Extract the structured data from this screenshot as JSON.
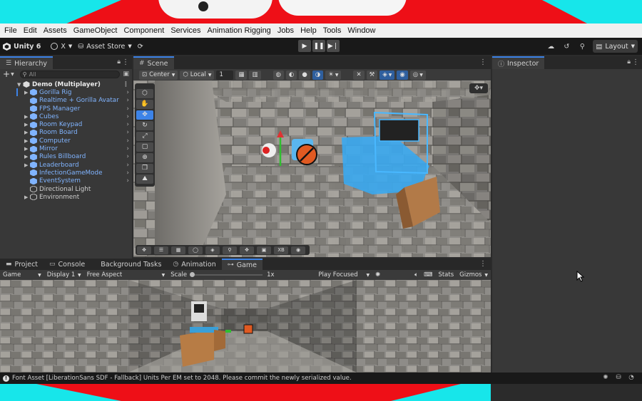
{
  "menu": [
    "File",
    "Edit",
    "Assets",
    "GameObject",
    "Component",
    "Services",
    "Animation Rigging",
    "Jobs",
    "Help",
    "Tools",
    "Window"
  ],
  "toolbar": {
    "app_name": "Unity 6",
    "account_label": "X",
    "asset_store_label": "Asset Store",
    "layout_label": "Layout"
  },
  "hierarchy": {
    "tab_label": "Hierarchy",
    "search_placeholder": "All",
    "root": "Demo (Multiplayer)",
    "items": [
      {
        "label": "Gorilla Rig",
        "prefab": true,
        "expandable": true
      },
      {
        "label": "Realtime + Gorilla Avatar",
        "prefab": true,
        "expandable": false
      },
      {
        "label": "FPS Manager",
        "prefab": true,
        "expandable": false
      },
      {
        "label": "Cubes",
        "prefab": true,
        "expandable": true
      },
      {
        "label": "Room Keypad",
        "prefab": true,
        "expandable": true
      },
      {
        "label": "Room Board",
        "prefab": true,
        "expandable": true
      },
      {
        "label": "Computer",
        "prefab": true,
        "expandable": true
      },
      {
        "label": "Mirror",
        "prefab": true,
        "expandable": true
      },
      {
        "label": "Rules Billboard",
        "prefab": true,
        "expandable": true
      },
      {
        "label": "Leaderboard",
        "prefab": true,
        "expandable": true
      },
      {
        "label": "InfectionGameMode",
        "prefab": true,
        "expandable": false
      },
      {
        "label": "EventSystem",
        "prefab": true,
        "expandable": false
      },
      {
        "label": "Directional Light",
        "prefab": false,
        "expandable": false
      },
      {
        "label": "Environment",
        "prefab": false,
        "expandable": true
      }
    ]
  },
  "scene": {
    "tab_label": "Scene",
    "pivot_label": "Center",
    "space_label": "Local",
    "grid_value": "1",
    "bottom_tool_label": "XB"
  },
  "inspector": {
    "tab_label": "Inspector"
  },
  "bottom": {
    "tabs": [
      "Project",
      "Console",
      "Background Tasks",
      "Animation",
      "Game"
    ],
    "active_tab": "Game",
    "game_bar": {
      "mode": "Game",
      "display": "Display 1",
      "aspect": "Free Aspect",
      "scale_label": "Scale",
      "scale_value": "1x",
      "play_mode": "Play Focused",
      "stats_label": "Stats",
      "gizmos_label": "Gizmos"
    }
  },
  "status": {
    "message": "Font Asset [LiberationSans SDF - Fallback] Units Per EM set to 2048. Please commit the newly serialized value."
  },
  "colors": {
    "accent": "#3c83e8",
    "prefab_text": "#80b4ff",
    "wallpaper_red": "#ee0f17",
    "wallpaper_cyan": "#17e6ea"
  }
}
